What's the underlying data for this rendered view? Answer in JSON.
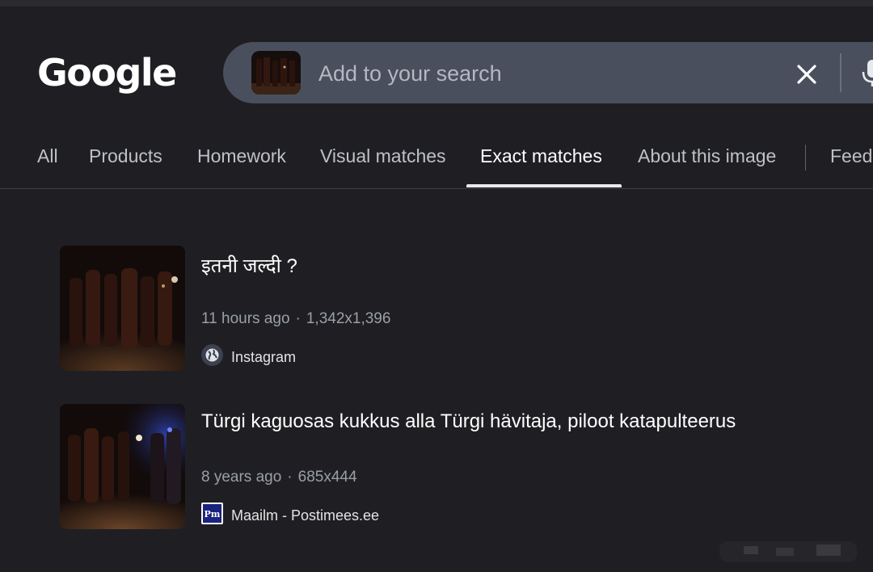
{
  "logo": "Google",
  "search": {
    "placeholder": "Add to your search"
  },
  "tabs": [
    {
      "label": "All"
    },
    {
      "label": "Products"
    },
    {
      "label": "Homework"
    },
    {
      "label": "Visual matches"
    },
    {
      "label": "Exact matches",
      "active": true
    },
    {
      "label": "About this image"
    },
    {
      "label": "Feed"
    }
  ],
  "results": [
    {
      "title": "इतनी जल्दी ?",
      "age": "11 hours ago",
      "dimensions": "1,342x1,396",
      "source": "Instagram",
      "source_icon": "globe-icon"
    },
    {
      "title": "Türgi kaguosas kukkus alla Türgi hävitaja, piloot katapulteerus",
      "age": "8 years ago",
      "dimensions": "685x444",
      "source": "Maailm - Postimees.ee",
      "source_icon": "postimees-logo",
      "source_icon_text": "Pm"
    }
  ],
  "colors": {
    "background": "#1f1f23",
    "search_bar": "#4a4f5e",
    "accent_underline": "#e8eaed",
    "meta_text": "#9aa0a6"
  },
  "icons": {
    "clear": "close-icon",
    "voice": "microphone-icon"
  }
}
